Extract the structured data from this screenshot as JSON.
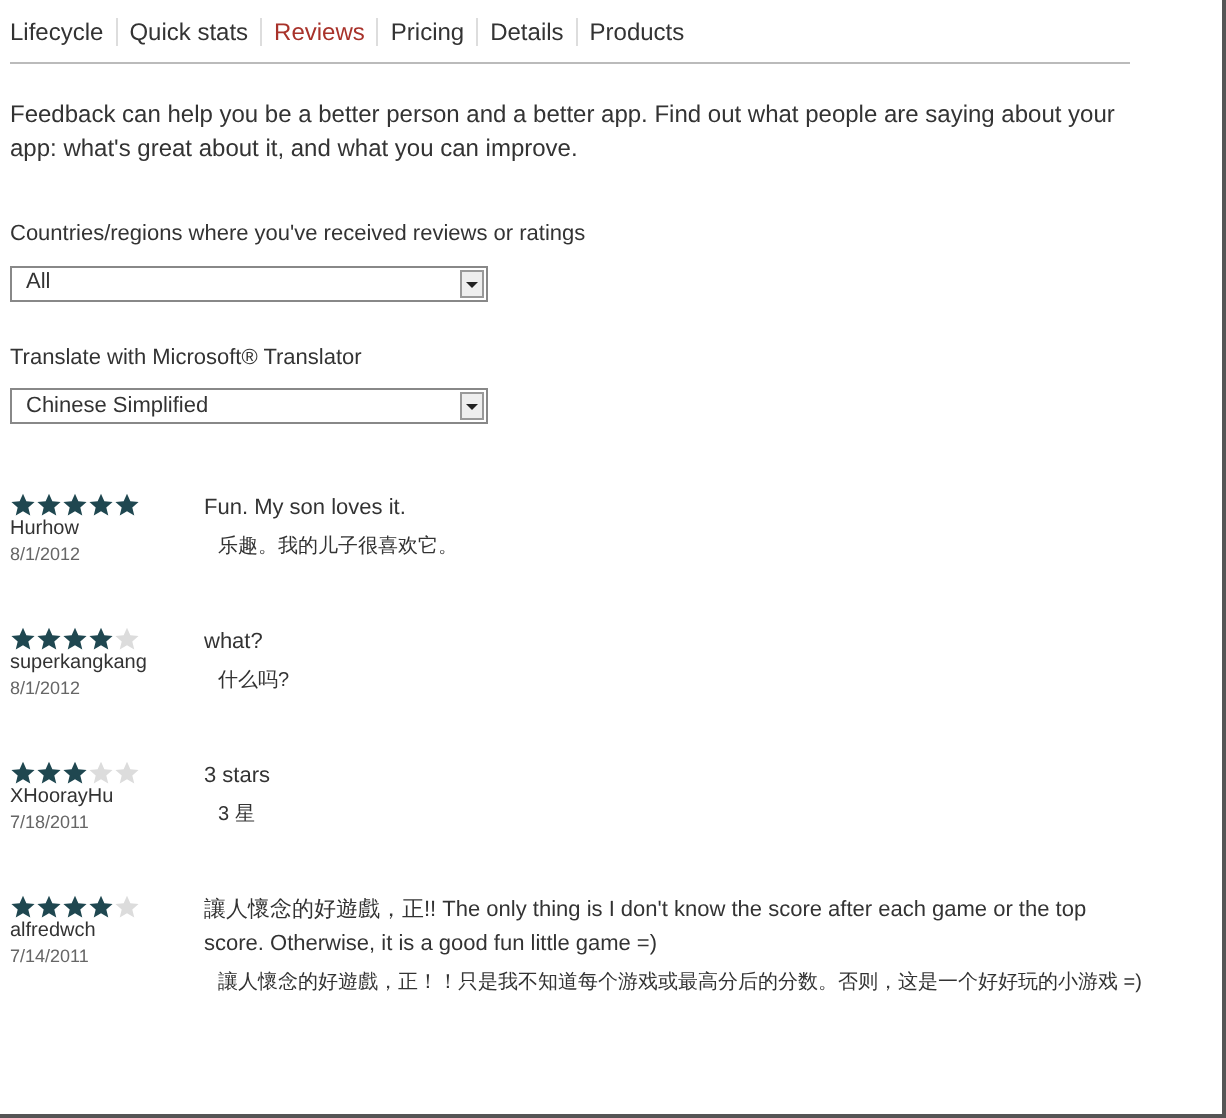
{
  "tabs": [
    {
      "label": "Lifecycle",
      "selected": false
    },
    {
      "label": "Quick stats",
      "selected": false
    },
    {
      "label": "Reviews",
      "selected": true
    },
    {
      "label": "Pricing",
      "selected": false
    },
    {
      "label": "Details",
      "selected": false
    },
    {
      "label": "Products",
      "selected": false
    }
  ],
  "intro": "Feedback can help you be a better person and a better app. Find out what people are saying about your app: what's great about it, and what you can improve.",
  "filters": [
    {
      "label": "Countries/regions where you've received reviews or ratings",
      "value": "All"
    },
    {
      "label": "Translate with Microsoft® Translator",
      "value": "Chinese Simplified"
    }
  ],
  "reviews": [
    {
      "stars": 5,
      "author": "Hurhow",
      "date": "8/1/2012",
      "text": "Fun. My son loves it.",
      "translation": "乐趣。我的儿子很喜欢它。"
    },
    {
      "stars": 4,
      "author": "superkangkang",
      "date": "8/1/2012",
      "text": "what?",
      "translation": "什么吗?"
    },
    {
      "stars": 3,
      "author": "XHoorayHu",
      "date": "7/18/2011",
      "text": "3 stars",
      "translation": "3 星"
    },
    {
      "stars": 4,
      "author": "alfredwch",
      "date": "7/14/2011",
      "text": "讓人懷念的好遊戲，正!! The only thing is I don't know the score after each game or the top score. Otherwise, it is a good fun little game =)",
      "translation": "讓人懷念的好遊戲，正！！只是我不知道每个游戏或最高分后的分数。否则，这是一个好好玩的小游戏 =)"
    }
  ]
}
